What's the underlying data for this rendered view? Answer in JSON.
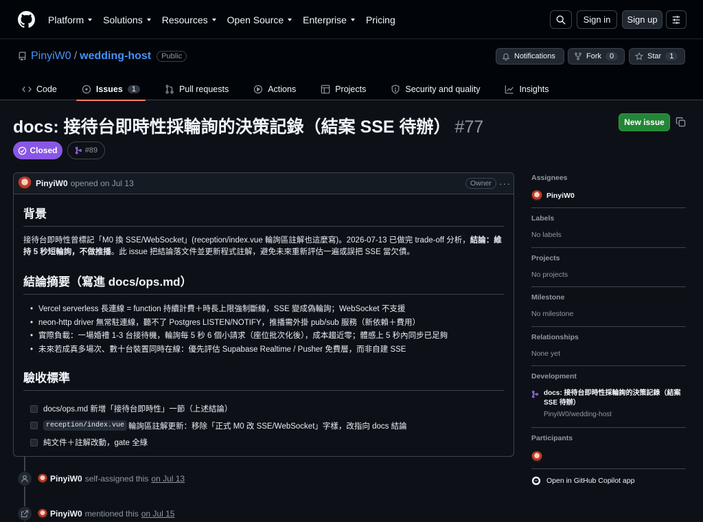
{
  "header": {
    "nav": [
      "Platform",
      "Solutions",
      "Resources",
      "Open Source",
      "Enterprise",
      "Pricing"
    ],
    "nav_has_dropdown": [
      true,
      true,
      true,
      true,
      true,
      false
    ],
    "sign_in": "Sign in",
    "sign_up": "Sign up"
  },
  "repo": {
    "owner": "PinyiW0",
    "separator": "/",
    "name": "wedding-host",
    "visibility": "Public",
    "notifications_label": "Notifications",
    "fork_label": "Fork",
    "fork_count": "0",
    "star_label": "Star",
    "star_count": "1",
    "tabs": [
      {
        "label": "Code",
        "icon": "code-icon"
      },
      {
        "label": "Issues",
        "icon": "issue-icon",
        "count": "1",
        "active": true
      },
      {
        "label": "Pull requests",
        "icon": "pull-request-icon"
      },
      {
        "label": "Actions",
        "icon": "play-icon"
      },
      {
        "label": "Projects",
        "icon": "table-icon"
      },
      {
        "label": "Security and quality",
        "icon": "shield-icon"
      },
      {
        "label": "Insights",
        "icon": "graph-icon"
      }
    ]
  },
  "issue": {
    "title": "docs: 接待台即時性採輪詢的決策記錄（結案 SSE 待辦）",
    "number": "#77",
    "new_issue_label": "New issue",
    "state": "Closed",
    "linked_pr": "#89"
  },
  "comment": {
    "author": "PinyiW0",
    "opened": "opened on Jul 13",
    "role": "Owner",
    "more": "···",
    "section1_title": "背景",
    "section1_text_a": "接待台即時性曾標記「M0 換 SSE/WebSocket」(reception/index.vue 輪詢區註解也這麼寫)。2026-07-13 已做完 trade-off 分析，",
    "section1_bold": "結論：維持 5 秒短輪詢，不做推播",
    "section1_text_b": "。此 issue 把結論落文件並更新程式註解，避免未來重新評估一遍或誤把 SSE 當欠債。",
    "section2_title": "結論摘要（寫進 docs/ops.md）",
    "bullets": [
      "Vercel serverless 長連線 = function 持續計費＋時長上限強制斷線，SSE 變成偽輪詢；WebSocket 不支援",
      "neon-http driver 無常駐連線，聽不了 Postgres LISTEN/NOTIFY，推播需外掛 pub/sub 服務（新依賴＋費用）",
      "實際負載：一場婚禮 1-3 台接待機，輪詢每 5 秒 6 個小請求（座位批次化後），成本趨近零；體感上 5 秒內同步已足夠",
      "未來若成真多場次、數十台裝置同時在線：優先評估 Supabase Realtime / Pusher 免費層，而非自建 SSE"
    ],
    "section3_title": "驗收標準",
    "task1": "docs/ops.md 新增「接待台即時性」一節（上述結論）",
    "task2_code": "reception/index.vue",
    "task2_text": "輪詢區註解更新：移除「正式 M0 改 SSE/WebSocket」字樣，改指向 docs 結論",
    "task3": "純文件＋註解改動，gate 全綠"
  },
  "timeline": [
    {
      "icon": "person-icon",
      "who": "PinyiW0",
      "what": "self-assigned this",
      "when": "on Jul 13"
    },
    {
      "icon": "cross-reference-icon",
      "who": "PinyiW0",
      "what": "mentioned this",
      "when": "on Jul 15"
    }
  ],
  "sidebar": {
    "assignees_label": "Assignees",
    "assignee": "PinyiW0",
    "labels_label": "Labels",
    "labels_value": "No labels",
    "projects_label": "Projects",
    "projects_value": "No projects",
    "milestone_label": "Milestone",
    "milestone_value": "No milestone",
    "relationships_label": "Relationships",
    "relationships_value": "None yet",
    "development_label": "Development",
    "dev_pr_title": "docs: 接待台即時性採輪詢的決策記錄（結案 SSE 待辦）",
    "dev_pr_repo": "PinyiW0/wedding-host",
    "participants_label": "Participants",
    "copilot_label": "Open in GitHub Copilot app"
  },
  "colors": {
    "background": "#0d1117",
    "header_bg": "#010409",
    "accent_link": "#4493f8",
    "closed_purple": "#8957e5",
    "new_issue_green": "#238636",
    "active_tab_underline": "#f78166"
  }
}
